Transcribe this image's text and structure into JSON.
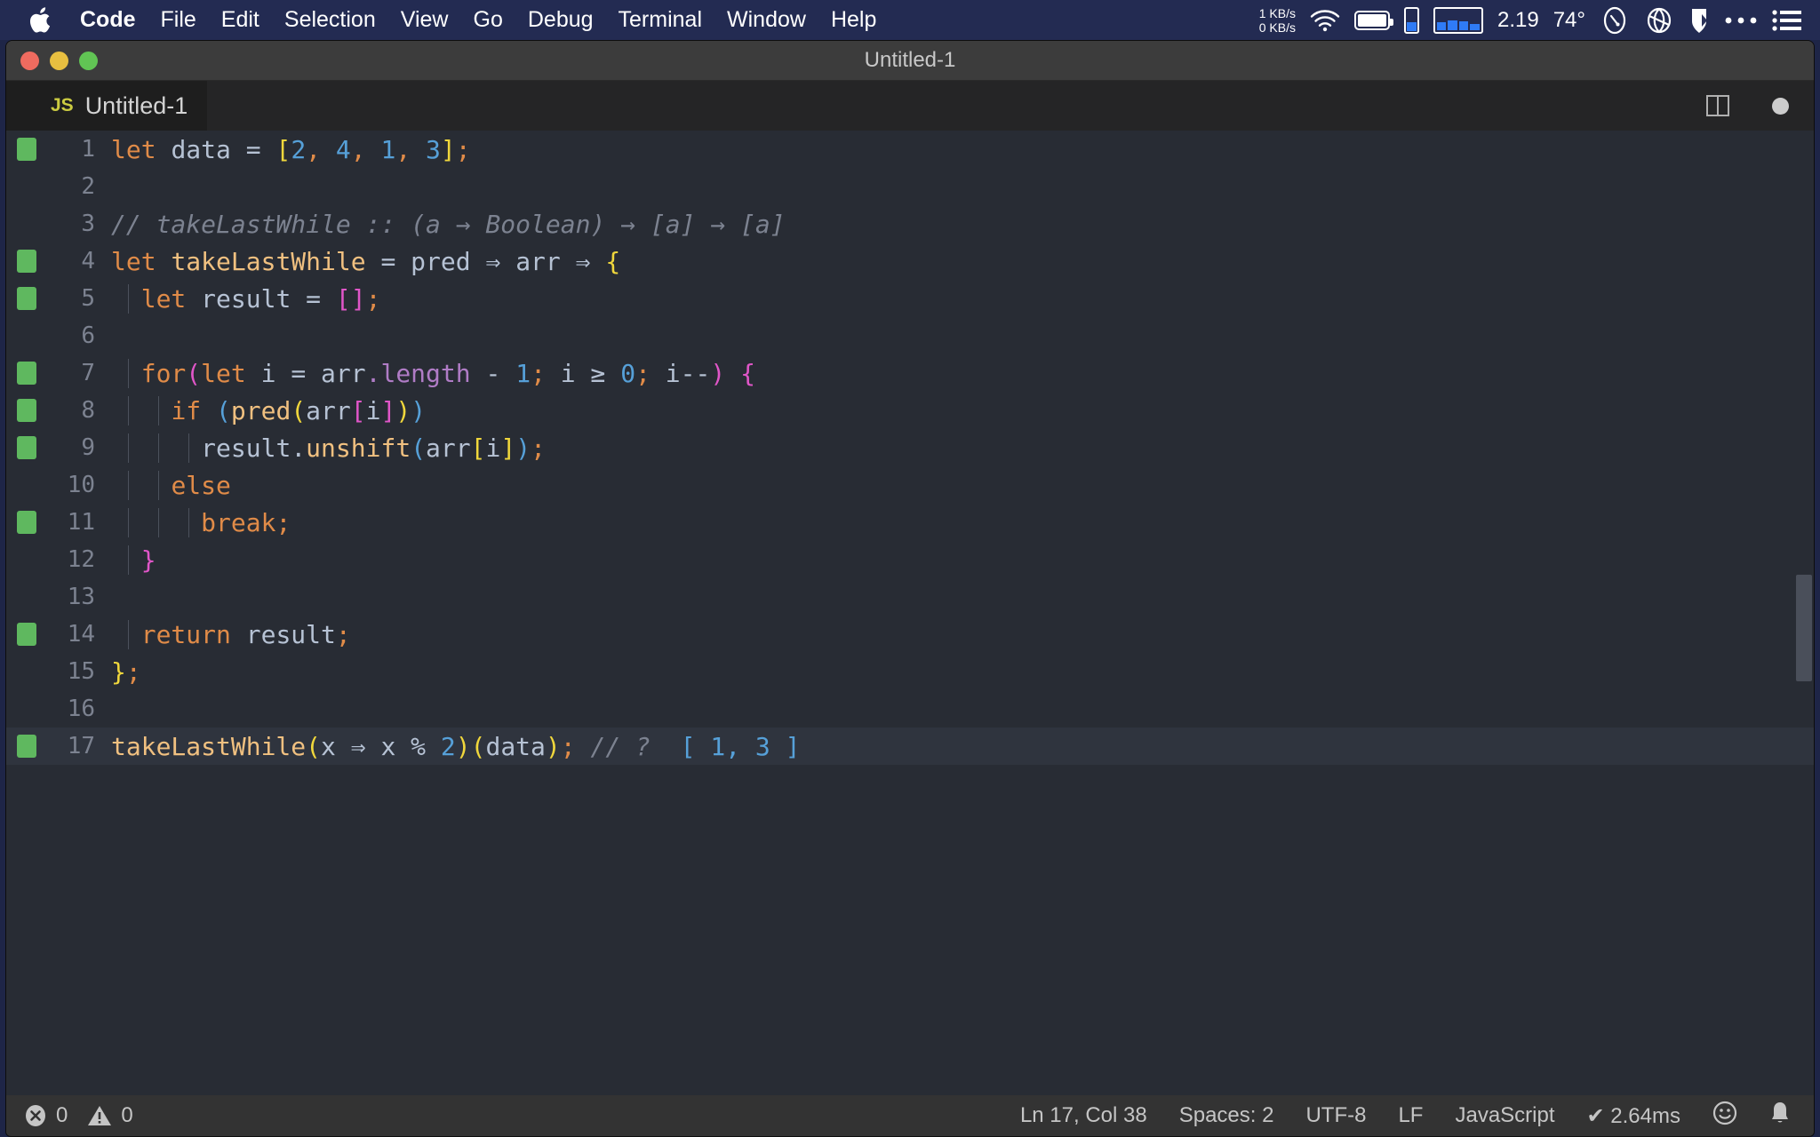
{
  "menubar": {
    "apple_icon": "apple-logo-icon",
    "items": [
      {
        "label": "Code",
        "bold": true
      },
      {
        "label": "File",
        "bold": false
      },
      {
        "label": "Edit",
        "bold": false
      },
      {
        "label": "Selection",
        "bold": false
      },
      {
        "label": "View",
        "bold": false
      },
      {
        "label": "Go",
        "bold": false
      },
      {
        "label": "Debug",
        "bold": false
      },
      {
        "label": "Terminal",
        "bold": false
      },
      {
        "label": "Window",
        "bold": false
      },
      {
        "label": "Help",
        "bold": false
      }
    ],
    "status": {
      "net_up": "1 KB/s",
      "net_down": "0 KB/s",
      "wifi_icon": "wifi-icon",
      "battery_icon": "battery-icon",
      "vbar_icon": "memory-bar-icon",
      "histogram_icon": "cpu-histogram-icon",
      "load_value": "2.19",
      "temperature": "74°",
      "gauge_icon": "speedometer-icon",
      "globe_icon": "network-globe-icon",
      "shield_icon": "shield-icon",
      "more_icon": "ellipsis-icon",
      "menu_icon": "list-menu-icon",
      "accent": "#2f7bf6"
    }
  },
  "window": {
    "title": "Untitled-1",
    "traffic_lights": {
      "close": "close-button",
      "minimize": "minimize-button",
      "zoom": "zoom-button",
      "close_color": "#ef6b5f",
      "minimize_color": "#e8bf40",
      "zoom_color": "#61c454"
    }
  },
  "tabbar": {
    "tab_badge": "JS",
    "tab_label": "Untitled-1",
    "split_icon": "split-editor-icon",
    "dirty_icon": "unsaved-dot-icon"
  },
  "editor": {
    "language": "JavaScript",
    "active_line": 17,
    "lines": [
      {
        "n": "1",
        "git": "added"
      },
      {
        "n": "2",
        "git": ""
      },
      {
        "n": "3",
        "git": ""
      },
      {
        "n": "4",
        "git": "added"
      },
      {
        "n": "5",
        "git": "added"
      },
      {
        "n": "6",
        "git": ""
      },
      {
        "n": "7",
        "git": "added"
      },
      {
        "n": "8",
        "git": "added"
      },
      {
        "n": "9",
        "git": "added"
      },
      {
        "n": "10",
        "git": ""
      },
      {
        "n": "11",
        "git": "added"
      },
      {
        "n": "12",
        "git": ""
      },
      {
        "n": "13",
        "git": ""
      },
      {
        "n": "14",
        "git": "added"
      },
      {
        "n": "15",
        "git": ""
      },
      {
        "n": "16",
        "git": ""
      },
      {
        "n": "17",
        "git": "added"
      }
    ],
    "source": [
      "let data = [2, 4, 1, 3];",
      "",
      "// takeLastWhile :: (a → Boolean) → [a] → [a]",
      "let takeLastWhile = pred ⇒ arr ⇒ {",
      "  let result = [];",
      "",
      "  for(let i = arr.length - 1; i ≥ 0; i--) {",
      "    if (pred(arr[i]))",
      "      result.unshift(arr[i]);",
      "    else",
      "      break;",
      "  }",
      "",
      "  return result;",
      "};",
      "",
      "takeLastWhile(x ⇒ x % 2)(data); // ? [ 1, 3 ]"
    ]
  },
  "statusbar": {
    "error_icon": "error-circle-icon",
    "error_count": "0",
    "warning_icon": "warning-triangle-icon",
    "warning_count": "0",
    "cursor": "Ln 17, Col 38",
    "indentation": "Spaces: 2",
    "encoding": "UTF-8",
    "eol": "LF",
    "language": "JavaScript",
    "runtime": "✔ 2.64ms",
    "feedback_icon": "smiley-icon",
    "bell_icon": "bell-icon"
  }
}
